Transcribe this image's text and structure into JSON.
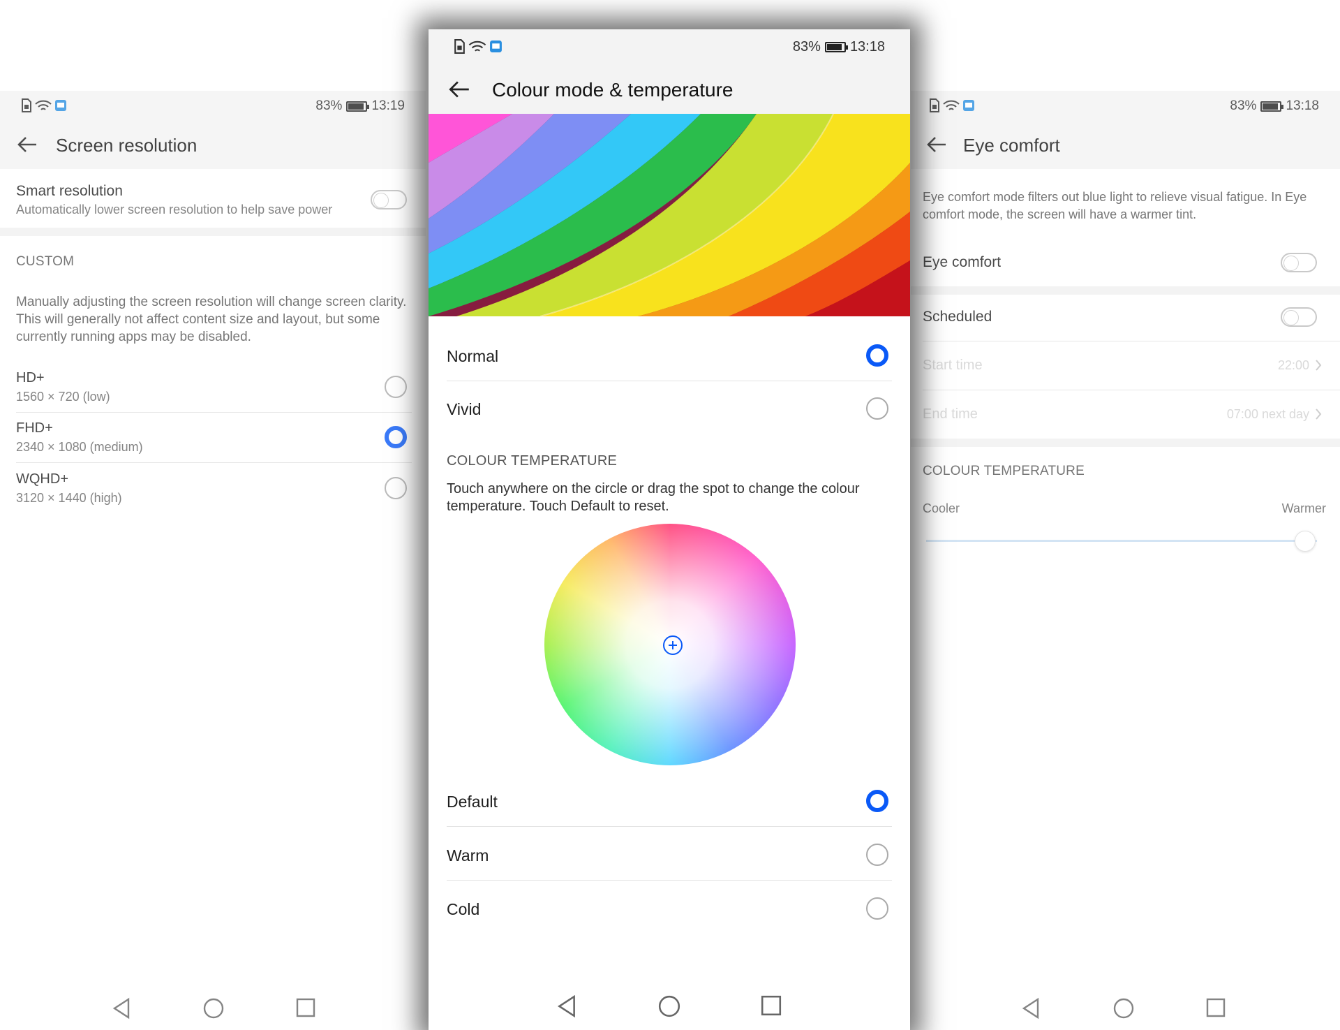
{
  "status_left": {
    "battery": "83%",
    "time": "13:19"
  },
  "status_center": {
    "battery": "83%",
    "time": "13:18"
  },
  "status_right": {
    "battery": "83%",
    "time": "13:18"
  },
  "left": {
    "title": "Screen resolution",
    "smart_title": "Smart resolution",
    "smart_sub": "Automatically lower screen resolution to help save power",
    "section": "CUSTOM",
    "desc": "Manually adjusting the screen resolution will change screen clarity. This will generally not affect content size and layout, but some currently running apps may be disabled.",
    "options": [
      {
        "label": "HD+",
        "detail": "1560 × 720 (low)",
        "selected": false
      },
      {
        "label": "FHD+",
        "detail": "2340 × 1080 (medium)",
        "selected": true
      },
      {
        "label": "WQHD+",
        "detail": "3120 × 1440 (high)",
        "selected": false
      }
    ]
  },
  "center": {
    "title": "Colour mode & temperature",
    "modes": [
      {
        "label": "Normal",
        "selected": true
      },
      {
        "label": "Vivid",
        "selected": false
      }
    ],
    "section": "COLOUR TEMPERATURE",
    "desc": "Touch anywhere on the circle or drag the spot to change the colour temperature. Touch Default to reset.",
    "temps": [
      {
        "label": "Default",
        "selected": true
      },
      {
        "label": "Warm",
        "selected": false
      },
      {
        "label": "Cold",
        "selected": false
      }
    ]
  },
  "right": {
    "title": "Eye comfort",
    "desc": "Eye comfort mode filters out blue light to relieve visual fatigue. In Eye comfort mode, the screen will have a warmer tint.",
    "eye_comfort": "Eye comfort",
    "scheduled": "Scheduled",
    "start_label": "Start time",
    "start_value": "22:00",
    "end_label": "End time",
    "end_value": "07:00 next day",
    "section": "COLOUR TEMPERATURE",
    "cooler": "Cooler",
    "warmer": "Warmer",
    "temperature_level": 0.97
  },
  "colors": {
    "accent": "#0a59f7"
  }
}
